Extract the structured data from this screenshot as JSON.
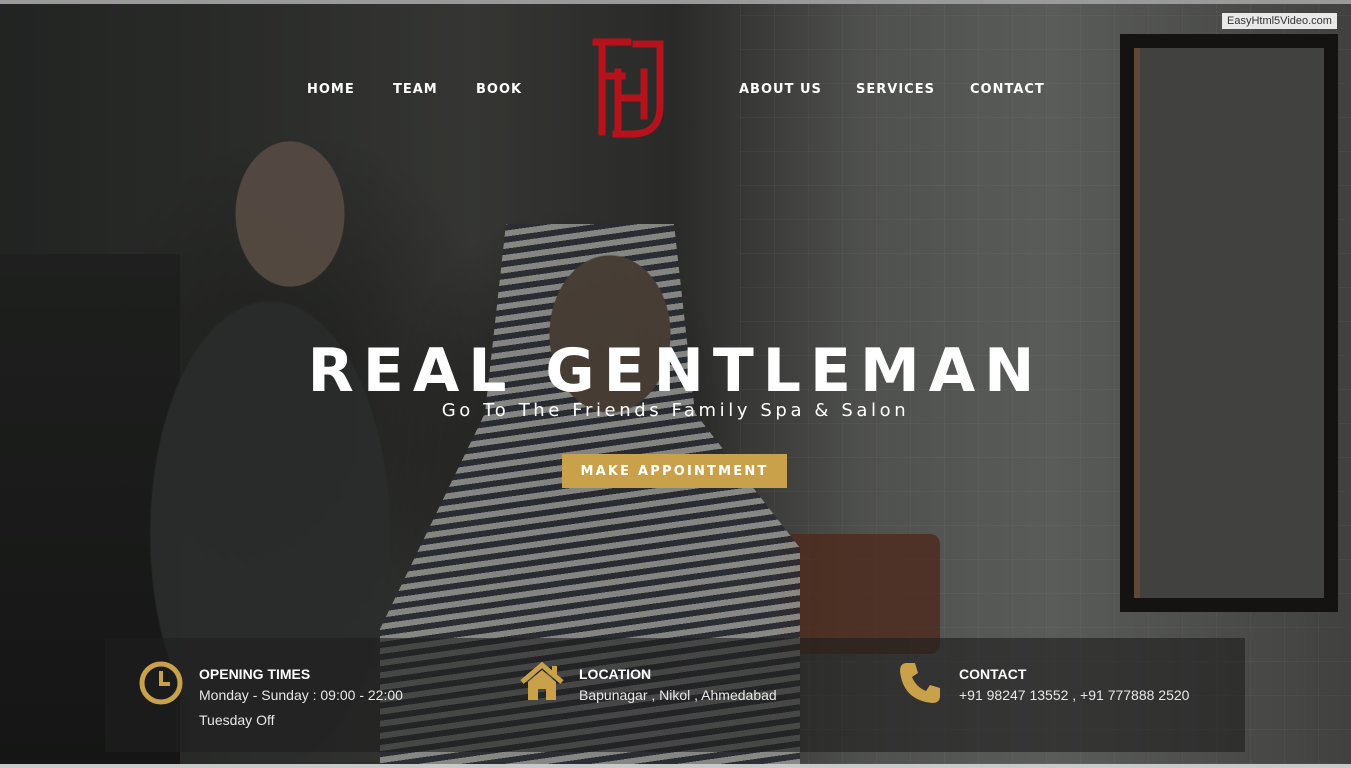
{
  "watermark": "EasyHtml5Video.com",
  "nav": {
    "left": [
      "HOME",
      "TEAM",
      "BOOK"
    ],
    "right": [
      "ABOUT US",
      "SERVICES",
      "CONTACT"
    ]
  },
  "logo": {
    "icon": "fhs-monogram-logo",
    "color": "#b5121b"
  },
  "hero": {
    "title": "REAL GENTLEMAN",
    "subtitle": "Go To The Friends Family Spa & Salon",
    "cta_label": "MAKE APPOINTMENT"
  },
  "info": {
    "opening": {
      "icon": "clock-icon",
      "title": "OPENING TIMES",
      "line1": "Monday - Sunday : 09:00 - 22:00",
      "line2": "Tuesday Off"
    },
    "location": {
      "icon": "home-icon",
      "title": "LOCATION",
      "line1": "Bapunagar , Nikol , Ahmedabad"
    },
    "contact": {
      "icon": "phone-icon",
      "title": "CONTACT",
      "line1": "+91 98247 13552 , +91 777888 2520"
    }
  },
  "colors": {
    "accent": "#c9a14a",
    "logo_red": "#b5121b",
    "text": "#ffffff"
  }
}
